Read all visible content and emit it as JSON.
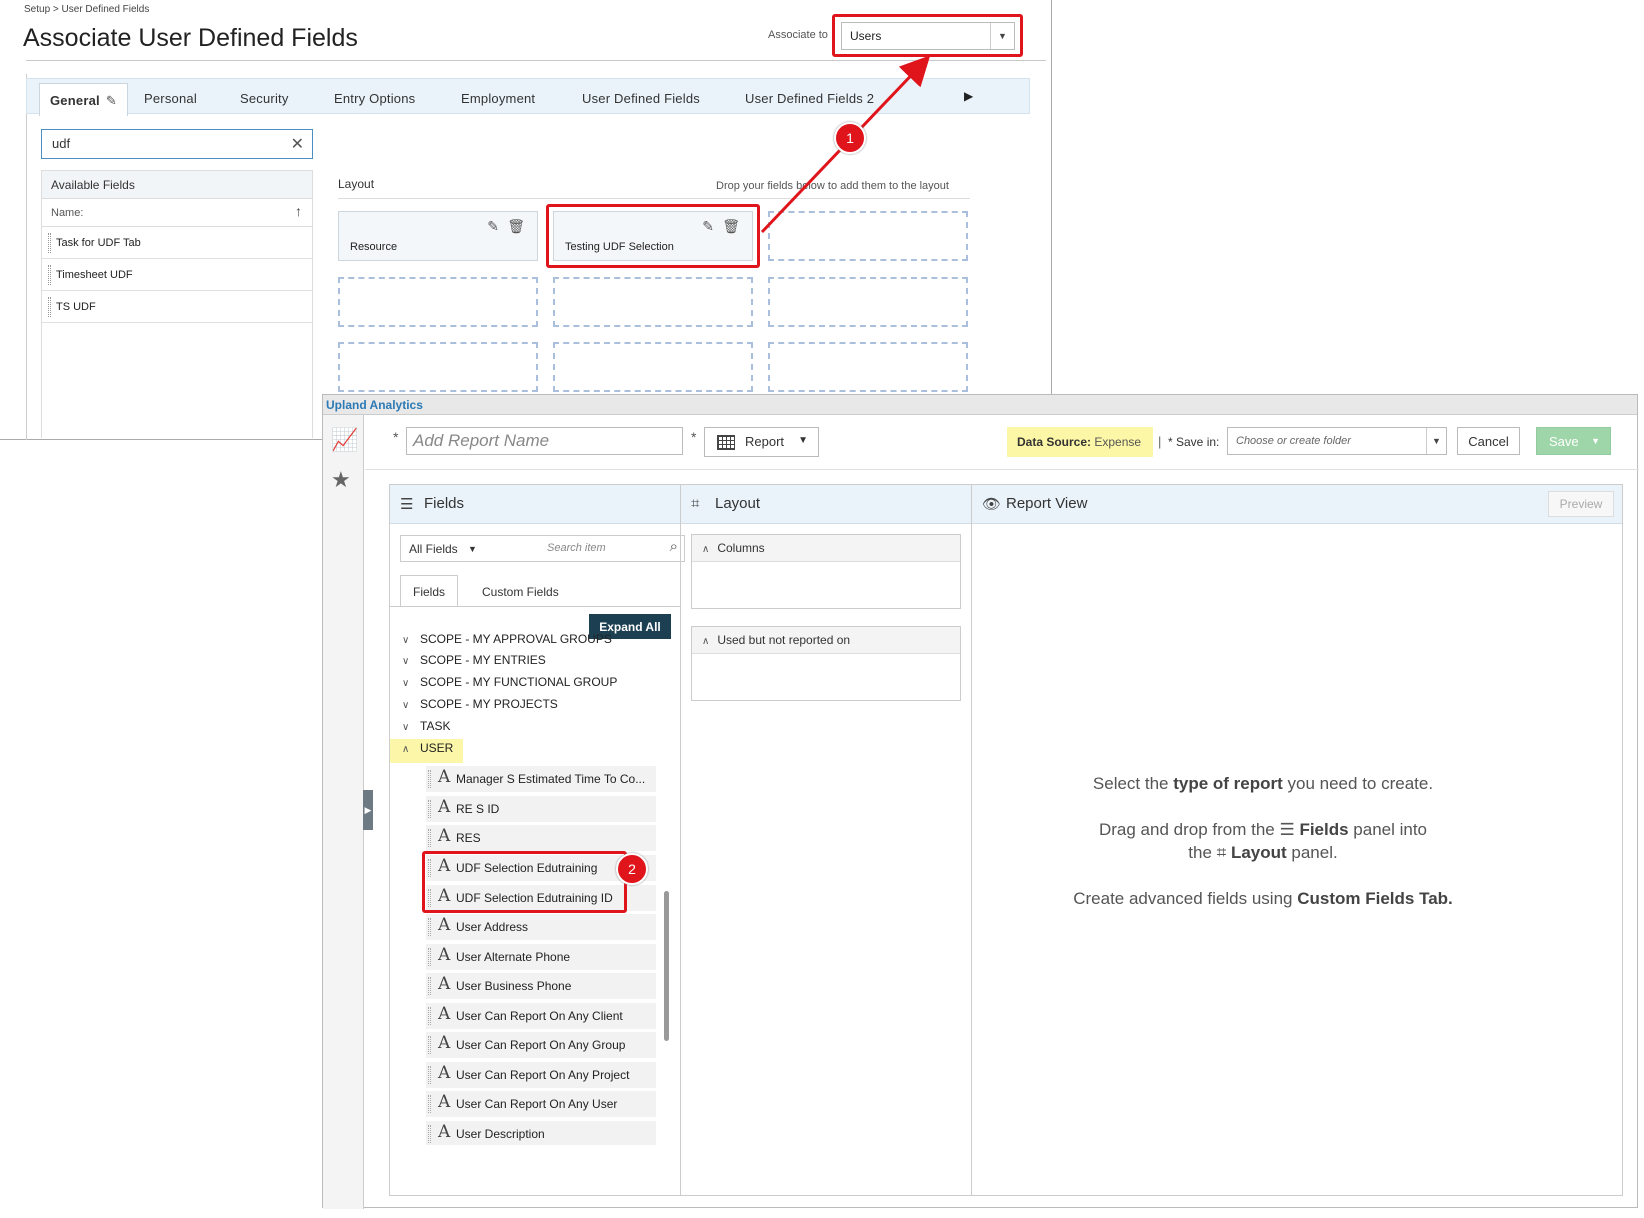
{
  "top": {
    "breadcrumb": "Setup > User Defined Fields",
    "title": "Associate User Defined Fields",
    "associate_label": "Associate to",
    "associate_value": "Users",
    "tabs": [
      "General",
      "Personal",
      "Security",
      "Entry Options",
      "Employment",
      "User Defined Fields",
      "User Defined Fields 2"
    ],
    "search_value": "udf",
    "available_fields_header": "Available Fields",
    "name_label": "Name:",
    "available_fields": [
      "Task for UDF Tab",
      "Timesheet UDF",
      "TS UDF"
    ],
    "layout_label": "Layout",
    "drop_hint": "Drop your fields below to add them to the layout",
    "layout_fields": [
      "Resource",
      "Testing UDF Selection"
    ]
  },
  "analytics": {
    "app_title": "Upland Analytics",
    "report_name_placeholder": "Add Report Name",
    "report_type": "Report",
    "data_source_label": "Data Source:",
    "data_source_value": "Expense",
    "pipe": "|",
    "save_in_label": "* Save in:",
    "folder_placeholder": "Choose or create folder",
    "cancel_label": "Cancel",
    "save_label": "Save",
    "fields_header": "Fields",
    "layout_header": "Layout",
    "report_view_header": "Report View",
    "preview_label": "Preview",
    "all_fields": "All Fields",
    "search_placeholder": "Search item",
    "tab_fields": "Fields",
    "tab_custom_fields": "Custom Fields",
    "expand_all": "Expand All",
    "tree_partial": "SCOPE - MY APPROVAL GROUPS",
    "tree": [
      "SCOPE - MY ENTRIES",
      "SCOPE - MY FUNCTIONAL GROUP",
      "SCOPE - MY PROJECTS",
      "TASK"
    ],
    "tree_open": "USER",
    "user_fields": [
      "Manager S Estimated Time To Co...",
      "RE S ID",
      "RES",
      "UDF Selection Edutraining",
      "UDF Selection Edutraining ID",
      "User Address",
      "User Alternate Phone",
      "User Business Phone",
      "User Can Report On Any Client",
      "User Can Report On Any Group",
      "User Can Report On Any Project",
      "User Can Report On Any User",
      "User Description"
    ],
    "columns_label": "Columns",
    "used_not_reported_label": "Used but not reported on",
    "rv": {
      "l1a": "Select the ",
      "l1b": "type of report",
      "l1c": " you need to create.",
      "l2a": "Drag and drop from the ",
      "l2b": "Fields",
      "l2c": " panel into",
      "l3a": "the ",
      "l3b": "Layout",
      "l3c": " panel.",
      "l4a": "Create advanced fields using ",
      "l4b": "Custom Fields Tab."
    }
  },
  "callouts": {
    "one": "1",
    "two": "2",
    "color": "#e0141b"
  }
}
